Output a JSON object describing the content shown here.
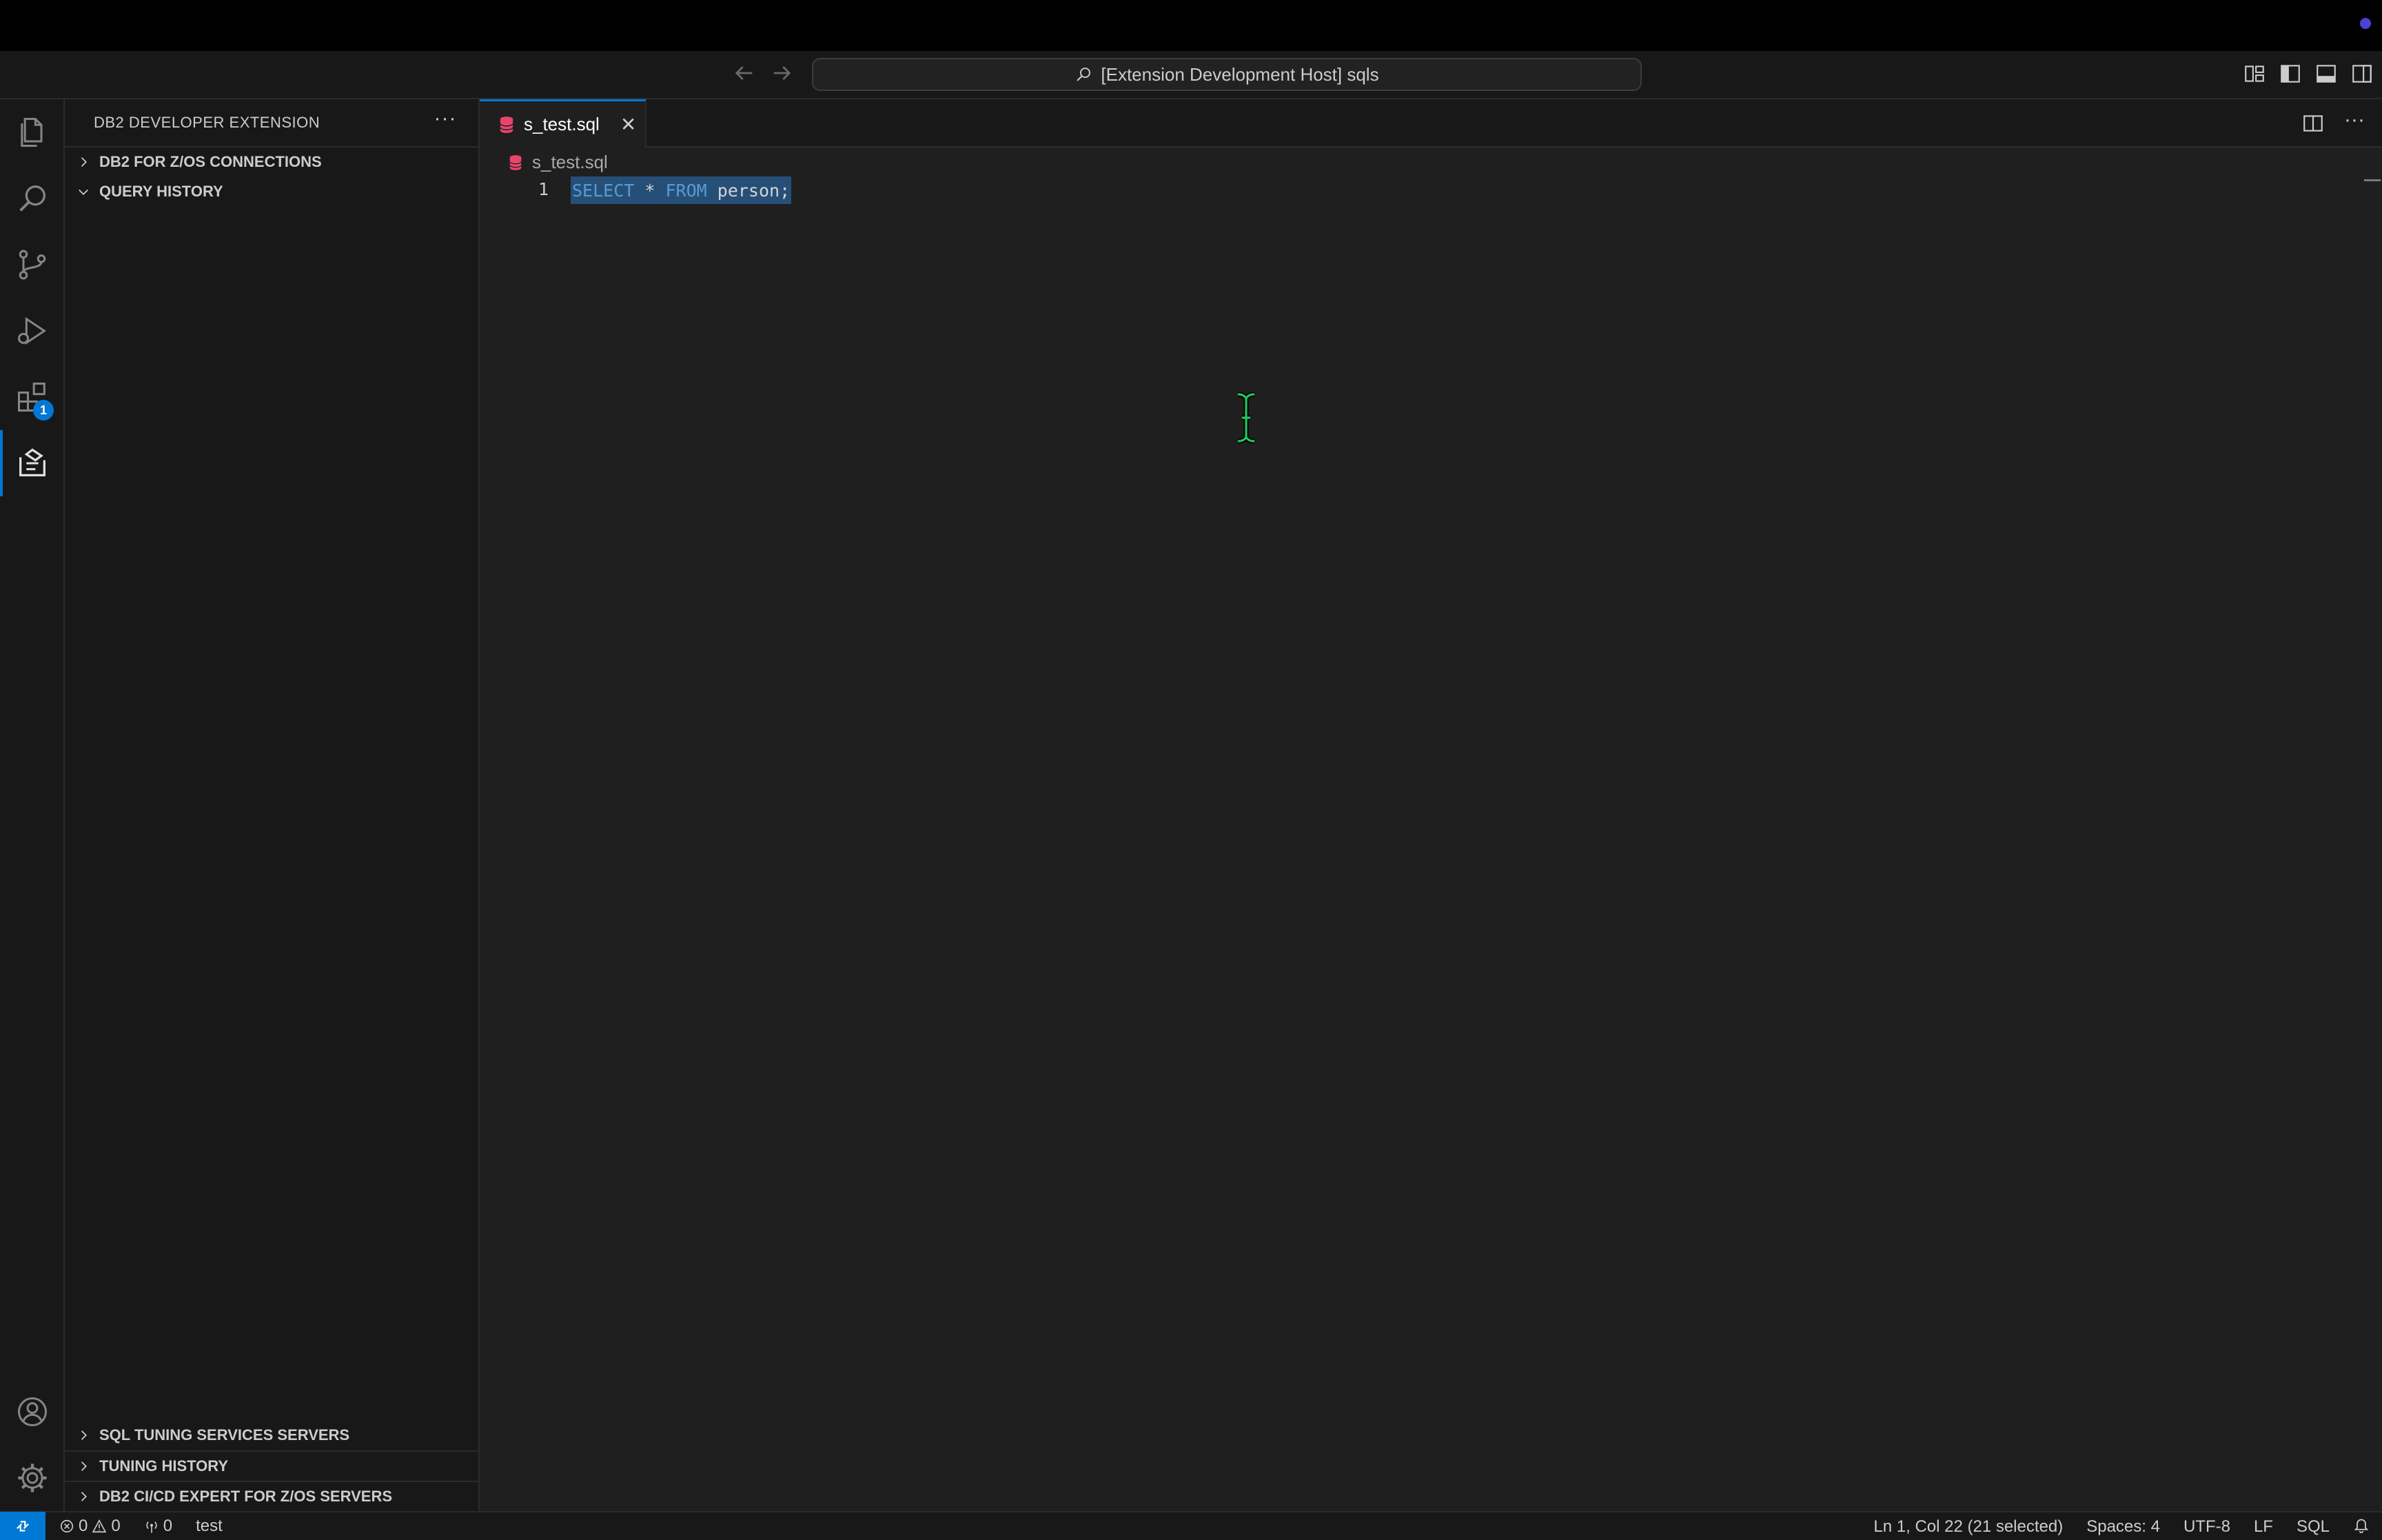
{
  "titlebar": {
    "search_text": "[Extension Development Host] sqls",
    "back_icon": "arrow-left-icon",
    "forward_icon": "arrow-right-icon"
  },
  "activity_bar": {
    "items": [
      {
        "name": "explorer-icon"
      },
      {
        "name": "search-icon"
      },
      {
        "name": "source-control-icon"
      },
      {
        "name": "run-debug-icon"
      },
      {
        "name": "extensions-icon",
        "badge": "1"
      },
      {
        "name": "db2-developer-icon"
      }
    ],
    "bottom": [
      {
        "name": "account-icon"
      },
      {
        "name": "manage-gear-icon"
      }
    ]
  },
  "sidebar": {
    "title": "DB2 DEVELOPER EXTENSION",
    "more": "···",
    "sections_top": [
      {
        "label": "DB2 FOR Z/OS CONNECTIONS",
        "expanded": false
      },
      {
        "label": "QUERY HISTORY",
        "expanded": true
      }
    ],
    "sections_bottom": [
      {
        "label": "SQL TUNING SERVICES SERVERS",
        "expanded": false
      },
      {
        "label": "TUNING HISTORY",
        "expanded": false
      },
      {
        "label": "DB2 CI/CD EXPERT FOR Z/OS SERVERS",
        "expanded": false
      }
    ]
  },
  "editor": {
    "tab": {
      "label": "s_test.sql",
      "close": "✕"
    },
    "actions": {
      "split": "split-editor-icon",
      "more": "···"
    },
    "breadcrumb": "s_test.sql",
    "lines": [
      {
        "number": "1",
        "tokens": [
          "SELECT",
          "*",
          "FROM",
          "person;"
        ]
      }
    ]
  },
  "statusbar": {
    "errors": "0",
    "warnings": "0",
    "ports": "0",
    "profile": "test",
    "position": "Ln 1, Col 22 (21 selected)",
    "spaces": "Spaces: 4",
    "encoding": "UTF-8",
    "eol": "LF",
    "language": "SQL"
  },
  "colors": {
    "accent": "#0078d4",
    "selection": "#264f78",
    "keyword": "#569cd6",
    "sql_icon": "#e8456b",
    "cursor": "#22c55e"
  }
}
